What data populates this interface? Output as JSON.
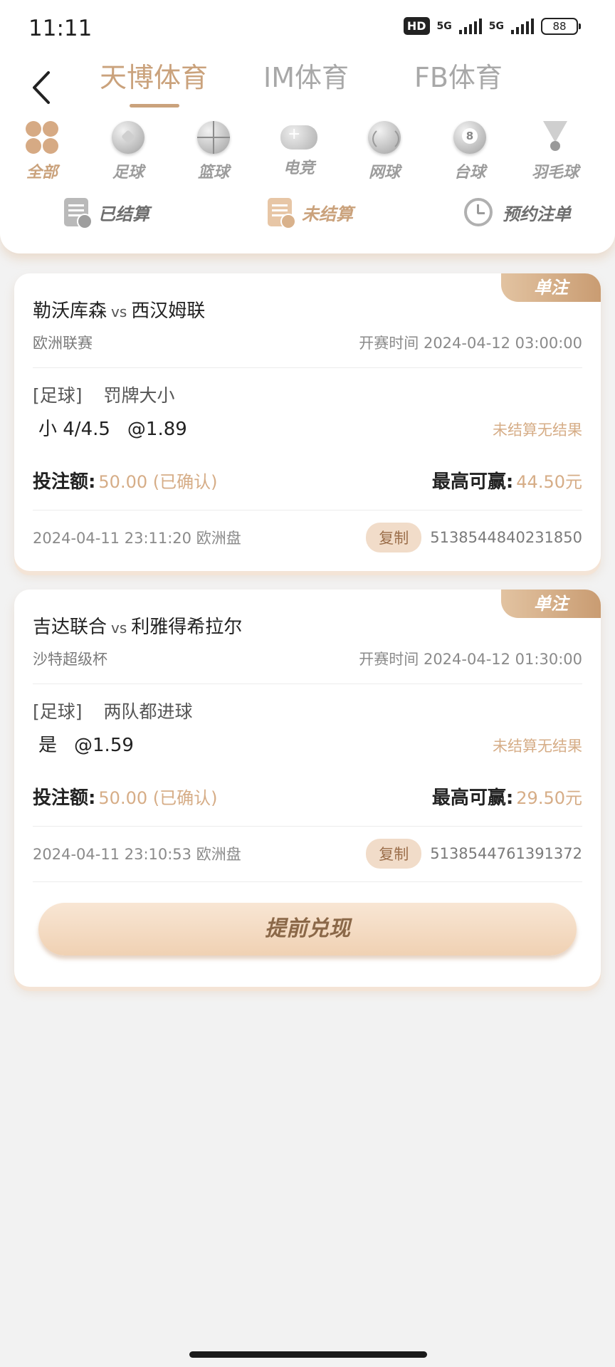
{
  "status_bar": {
    "time": "11:11",
    "hd_label": "HD",
    "net1": "5G",
    "net2": "5G",
    "battery": "88"
  },
  "provider_tabs": [
    {
      "label": "天博体育",
      "active": true
    },
    {
      "label": "IM体育",
      "active": false
    },
    {
      "label": "FB体育",
      "active": false
    }
  ],
  "sports": [
    {
      "label": "全部",
      "icon": "clover-icon",
      "active": true
    },
    {
      "label": "足球",
      "icon": "soccer-ball-icon"
    },
    {
      "label": "篮球",
      "icon": "basketball-icon"
    },
    {
      "label": "电竞",
      "icon": "gamepad-icon"
    },
    {
      "label": "网球",
      "icon": "tennis-ball-icon"
    },
    {
      "label": "台球",
      "icon": "billiard-ball-icon"
    },
    {
      "label": "羽毛球",
      "icon": "shuttlecock-icon"
    }
  ],
  "filters": [
    {
      "label": "已结算",
      "icon": "settled-icon"
    },
    {
      "label": "未结算",
      "icon": "unsettled-icon",
      "active": true
    },
    {
      "label": "预约注单",
      "icon": "alarm-clock-icon"
    }
  ],
  "bets": [
    {
      "badge": "单注",
      "home": "勒沃库森",
      "vs": "vs",
      "away": "西汉姆联",
      "league": "欧洲联赛",
      "start_label": "开赛时间",
      "start_time": "2024-04-12 03:00:00",
      "sport_tag": "[足球]",
      "market": "罚牌大小",
      "selection": "小 4/4.5",
      "odds": "@1.89",
      "result": "未结算无结果",
      "stake_label": "投注额:",
      "stake": "50.00 (已确认)",
      "maxwin_label": "最高可赢:",
      "maxwin": "44.50元",
      "placed": "2024-04-11 23:11:20 欧洲盘",
      "copy_label": "复制",
      "order_id": "5138544840231850"
    },
    {
      "badge": "单注",
      "home": "吉达联合",
      "vs": "vs",
      "away": "利雅得希拉尔",
      "league": "沙特超级杯",
      "start_label": "开赛时间",
      "start_time": "2024-04-12 01:30:00",
      "sport_tag": "[足球]",
      "market": "两队都进球",
      "selection": "是",
      "odds": "@1.59",
      "result": "未结算无结果",
      "stake_label": "投注额:",
      "stake": "50.00 (已确认)",
      "maxwin_label": "最高可赢:",
      "maxwin": "29.50元",
      "placed": "2024-04-11 23:10:53 欧洲盘",
      "copy_label": "复制",
      "order_id": "5138544761391372"
    }
  ],
  "cashout_label": "提前兑现",
  "colors": {
    "accent": "#caa27c",
    "accent_text": "#d6ad87",
    "background": "#f2f2f2"
  }
}
